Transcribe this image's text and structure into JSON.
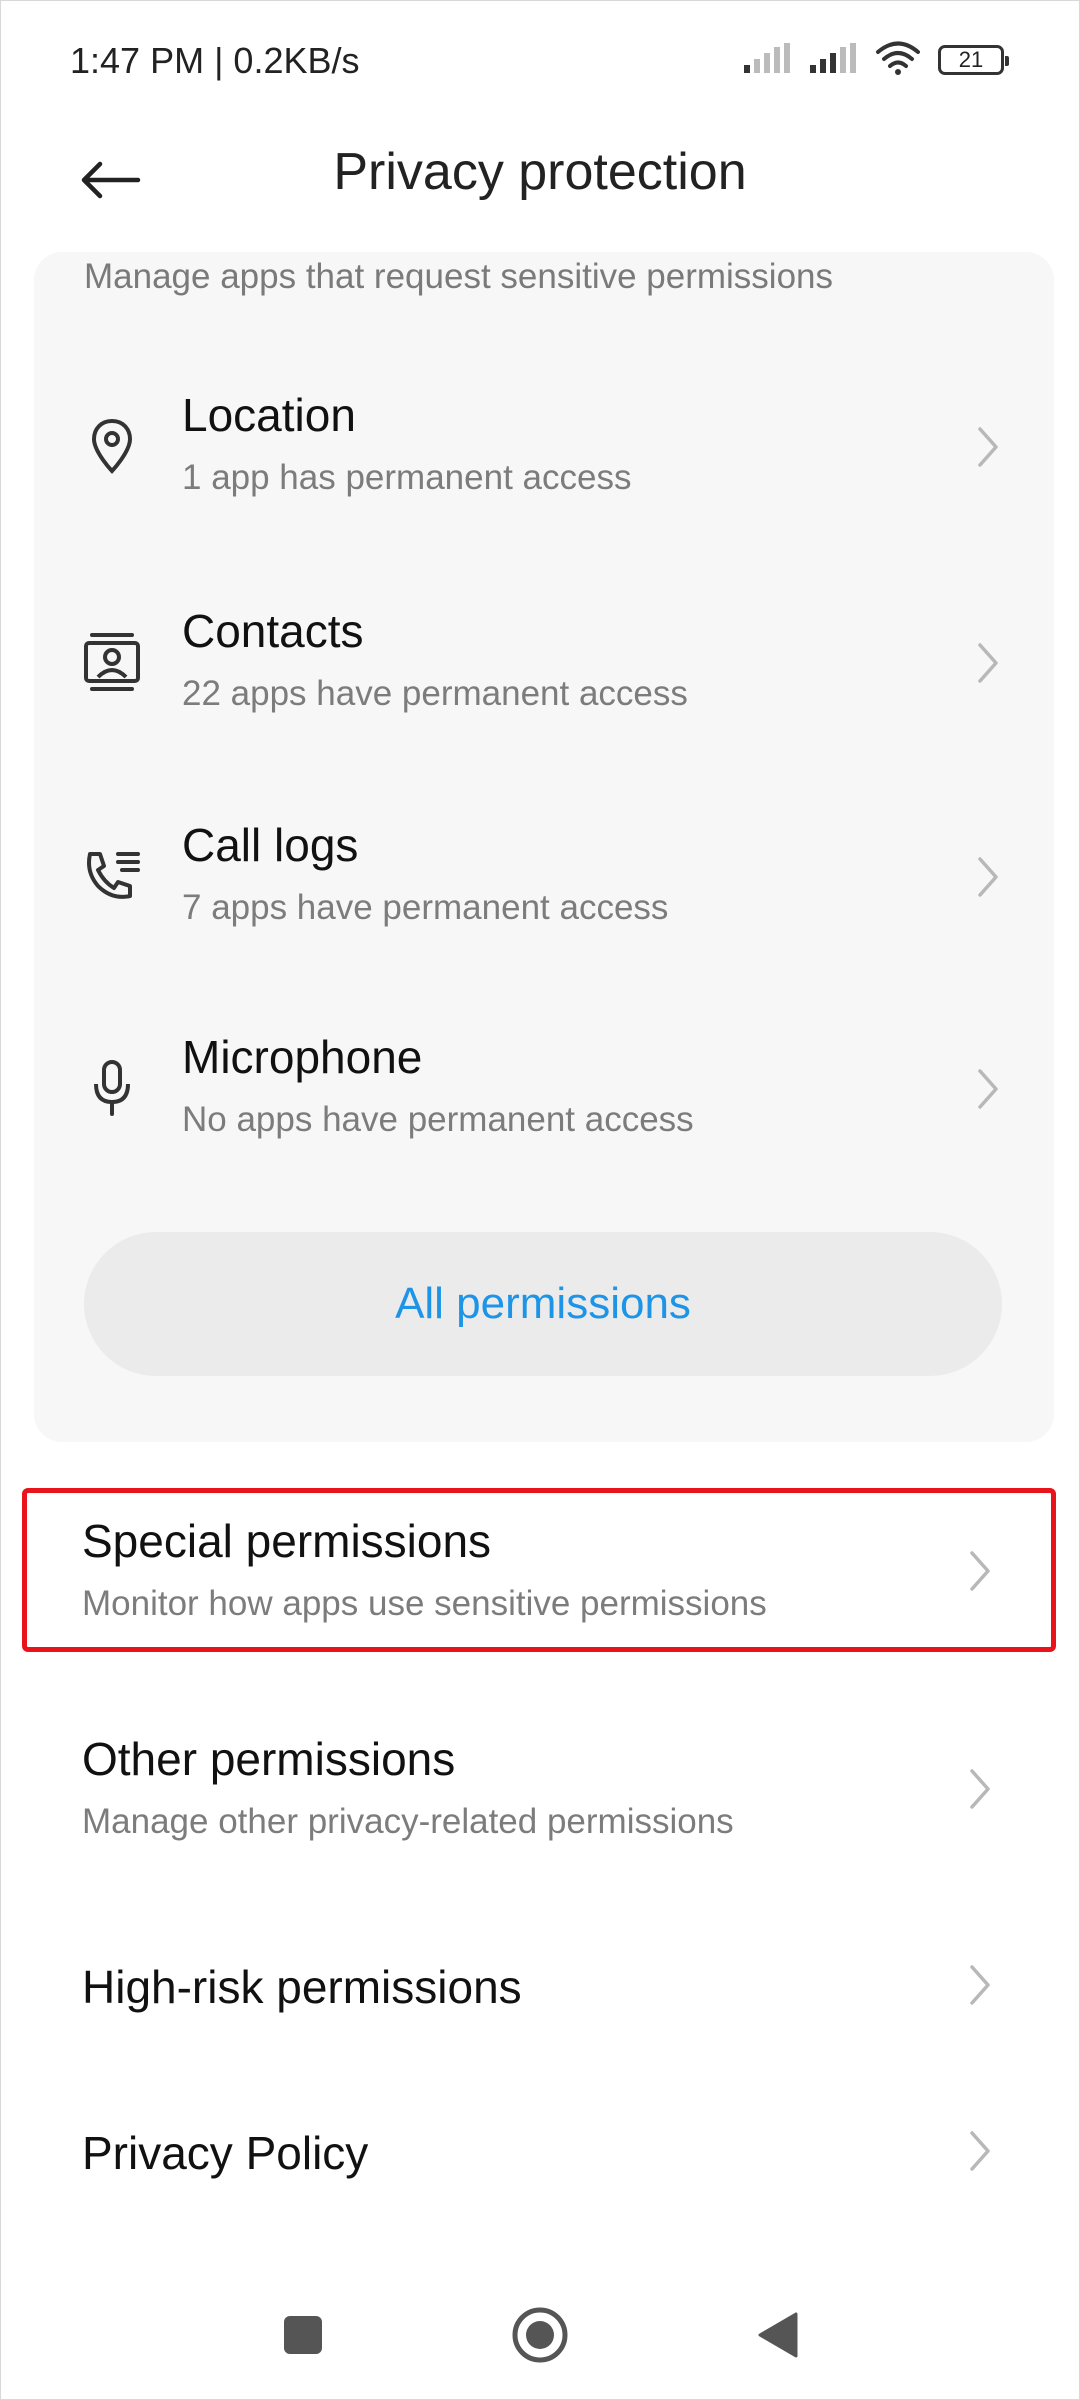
{
  "status_bar": {
    "time": "1:47 PM | 0.2KB/s",
    "battery": "21",
    "icons": [
      "signal-icon",
      "signal-icon",
      "wifi-icon",
      "battery-icon"
    ]
  },
  "header": {
    "title": "Privacy protection",
    "back_icon": "back-arrow-icon"
  },
  "permissions_card": {
    "description": "Manage apps that request sensitive permissions",
    "items": [
      {
        "icon": "location-icon",
        "title": "Location",
        "subtitle": "1 app has permanent access"
      },
      {
        "icon": "contacts-icon",
        "title": "Contacts",
        "subtitle": "22 apps have permanent access"
      },
      {
        "icon": "call-logs-icon",
        "title": "Call logs",
        "subtitle": "7 apps have permanent access"
      },
      {
        "icon": "microphone-icon",
        "title": "Microphone",
        "subtitle": "No apps have permanent access"
      }
    ],
    "all_permissions_label": "All permissions"
  },
  "list": {
    "items": [
      {
        "title": "Special permissions",
        "subtitle": "Monitor how apps use sensitive permissions",
        "highlighted": true
      },
      {
        "title": "Other permissions",
        "subtitle": "Manage other privacy-related permissions"
      },
      {
        "title": "High-risk permissions",
        "subtitle": ""
      },
      {
        "title": "Privacy Policy",
        "subtitle": ""
      }
    ]
  },
  "nav_bar": {
    "buttons": [
      "recents-icon",
      "home-icon",
      "back-triangle-icon"
    ]
  },
  "colors": {
    "accent": "#1e94e6",
    "highlight": "#e8131b",
    "card_bg": "#f7f7f7",
    "button_bg": "#ebebeb"
  }
}
